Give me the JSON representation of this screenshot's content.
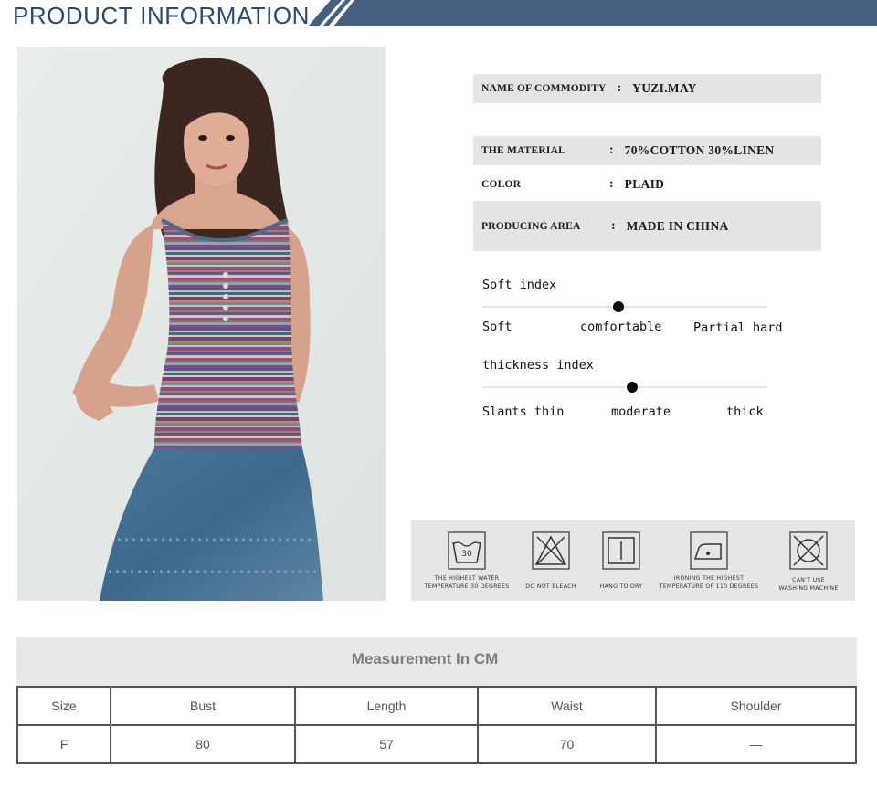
{
  "header": {
    "title": "PRODUCT INFORMATION",
    "accent_color": "#465e80"
  },
  "product_photo": {
    "description_name": "model-wearing-striped-tank-top"
  },
  "info": {
    "name_label": "NAME OF COMMODITY",
    "name_colon": ":",
    "name_value": "YUZI.MAY",
    "material_label": "THE MATERIAL",
    "material_colon": ":",
    "material_value": "70%COTTON  30%LINEN",
    "color_label": "COLOR",
    "color_colon": ":",
    "color_value": "PLAID",
    "area_label": "PRODUCING AREA",
    "area_colon": ":",
    "area_value": "MADE IN CHINA"
  },
  "soft_index": {
    "title": "Soft index",
    "labels": [
      "Soft",
      "comfortable",
      "Partial hard"
    ],
    "level": 0.5
  },
  "thickness_index": {
    "title": "thickness index",
    "labels": [
      "Slants thin",
      "moderate",
      "thick"
    ],
    "level": 0.5
  },
  "care": [
    {
      "icon": "wash-30-icon",
      "number": "30",
      "line1": "THE HIGHEST WATER",
      "line2": "TEMPERATURE 30 DEGREES"
    },
    {
      "icon": "do-not-bleach-icon",
      "line1": "",
      "line2": "DO NOT BLEACH"
    },
    {
      "icon": "hang-to-dry-icon",
      "line1": "",
      "line2": "HANG TO DRY"
    },
    {
      "icon": "iron-icon",
      "line1": "IRONING THE HIGHEST",
      "line2": "TEMPERATURE OF 110 DEGREES"
    },
    {
      "icon": "no-machine-wash-icon",
      "line1": "CAN'T USE",
      "line2": "WASHING MACHINE"
    }
  ],
  "measurement": {
    "title": "Measurement In CM",
    "columns": [
      "Size",
      "Bust",
      "Length",
      "Waist",
      "Shoulder"
    ],
    "rows": [
      [
        "F",
        "80",
        "57",
        "70",
        "—"
      ]
    ]
  }
}
